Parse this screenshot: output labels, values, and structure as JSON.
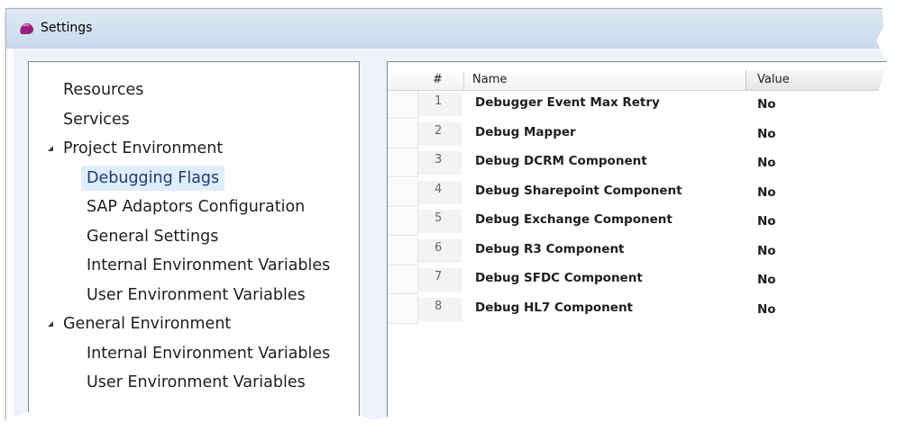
{
  "window": {
    "title": "Settings",
    "icon": "app-blob-icon",
    "accent": "#9b1f7a"
  },
  "tree": {
    "items": [
      {
        "label": "Resources",
        "level": 0,
        "expander": false,
        "selected": false
      },
      {
        "label": "Services",
        "level": 0,
        "expander": false,
        "selected": false
      },
      {
        "label": "Project Environment",
        "level": 0,
        "expander": true,
        "selected": false
      },
      {
        "label": "Debugging Flags",
        "level": 1,
        "expander": false,
        "selected": true
      },
      {
        "label": "SAP Adaptors Configuration",
        "level": 1,
        "expander": false,
        "selected": false
      },
      {
        "label": "General Settings",
        "level": 1,
        "expander": false,
        "selected": false
      },
      {
        "label": "Internal Environment Variables",
        "level": 1,
        "expander": false,
        "selected": false
      },
      {
        "label": "User Environment Variables",
        "level": 1,
        "expander": false,
        "selected": false
      },
      {
        "label": "General Environment",
        "level": 0,
        "expander": true,
        "selected": false
      },
      {
        "label": "Internal Environment Variables",
        "level": 1,
        "expander": false,
        "selected": false
      },
      {
        "label": "User Environment Variables",
        "level": 1,
        "expander": false,
        "selected": false
      }
    ]
  },
  "grid": {
    "columns": {
      "num": "#",
      "name": "Name",
      "value": "Value"
    },
    "rows": [
      {
        "num": "1",
        "name": "Debugger Event Max Retry",
        "value": "No"
      },
      {
        "num": "2",
        "name": "Debug Mapper",
        "value": "No"
      },
      {
        "num": "3",
        "name": "Debug DCRM Component",
        "value": "No"
      },
      {
        "num": "4",
        "name": "Debug Sharepoint Component",
        "value": "No"
      },
      {
        "num": "5",
        "name": "Debug Exchange Component",
        "value": "No"
      },
      {
        "num": "6",
        "name": "Debug R3 Component",
        "value": "No"
      },
      {
        "num": "7",
        "name": "Debug SFDC Component",
        "value": "No"
      },
      {
        "num": "8",
        "name": "Debug HL7 Component",
        "value": "No"
      }
    ]
  }
}
